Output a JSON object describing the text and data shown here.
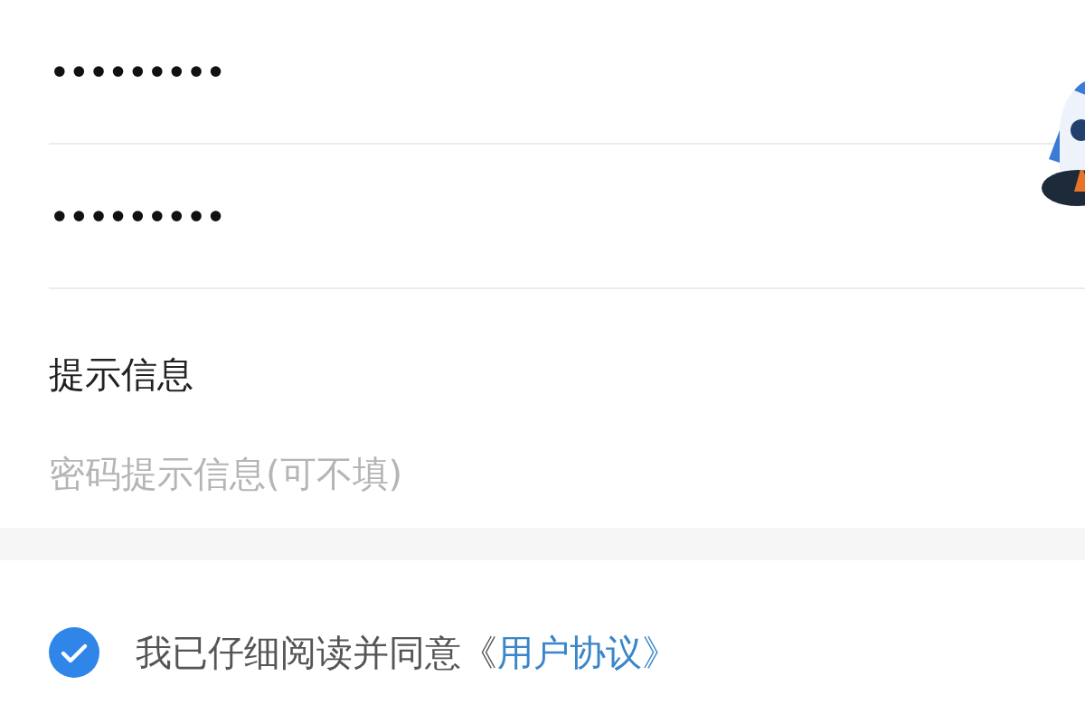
{
  "password_fields": [
    {
      "value": "•••••••••"
    },
    {
      "value": "•••••••••"
    }
  ],
  "hint": {
    "label": "提示信息",
    "placeholder": "密码提示信息(可不填)"
  },
  "agreement": {
    "checked": true,
    "text": "我已仔细阅读并同意《",
    "link": "用户协议》"
  }
}
